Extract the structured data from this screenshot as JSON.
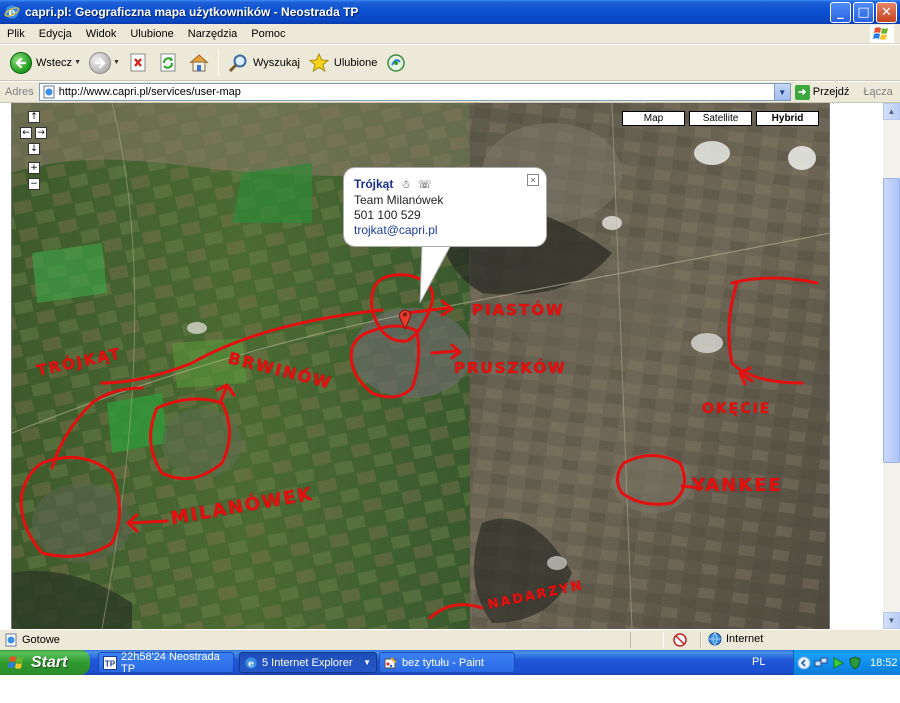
{
  "window": {
    "title": "capri.pl: Geograficzna mapa użytkowników - Neostrada TP",
    "controls": {
      "minimize": "_",
      "maximize": "□",
      "close": "✕"
    }
  },
  "menu": [
    "Plik",
    "Edycja",
    "Widok",
    "Ulubione",
    "Narzędzia",
    "Pomoc"
  ],
  "toolbar": {
    "back_label": "Wstecz",
    "search_label": "Wyszukaj",
    "favorites_label": "Ulubione"
  },
  "address": {
    "label": "Adres",
    "url": "http://www.capri.pl/services/user-map",
    "go_label": "Przejdź",
    "links_label": "Łącza"
  },
  "map": {
    "type_buttons": [
      {
        "label": "Map",
        "active": false
      },
      {
        "label": "Satellite",
        "active": false
      },
      {
        "label": "Hybrid",
        "active": true
      }
    ],
    "pan_zoom": {
      "up": "↑",
      "left": "←",
      "right": "→",
      "down": "↓",
      "zoom_in": "+",
      "zoom_out": "−"
    },
    "info_window": {
      "name": "Trójkąt",
      "team": "Team Milanówek",
      "phone": "501 100 529",
      "email": "trojkat@capri.pl",
      "close": "×"
    },
    "annotation_color": "#e41010",
    "annotations": [
      "TRÓJKĄT",
      "BRWINÓW",
      "PIASTÓW",
      "PRUSZKÓW",
      "OKĘCIE",
      "YANKEE",
      "MILANÓWEK",
      "NADARZYN"
    ]
  },
  "status": {
    "text": "Gotowe",
    "zone": "Internet"
  },
  "taskbar": {
    "start_label": "Start",
    "buttons": [
      {
        "label": "22h58'24 Neostrada TP"
      },
      {
        "label": "5 Internet Explorer"
      },
      {
        "label": "bez tytułu - Paint"
      }
    ],
    "language": "PL",
    "clock": "18:52"
  }
}
